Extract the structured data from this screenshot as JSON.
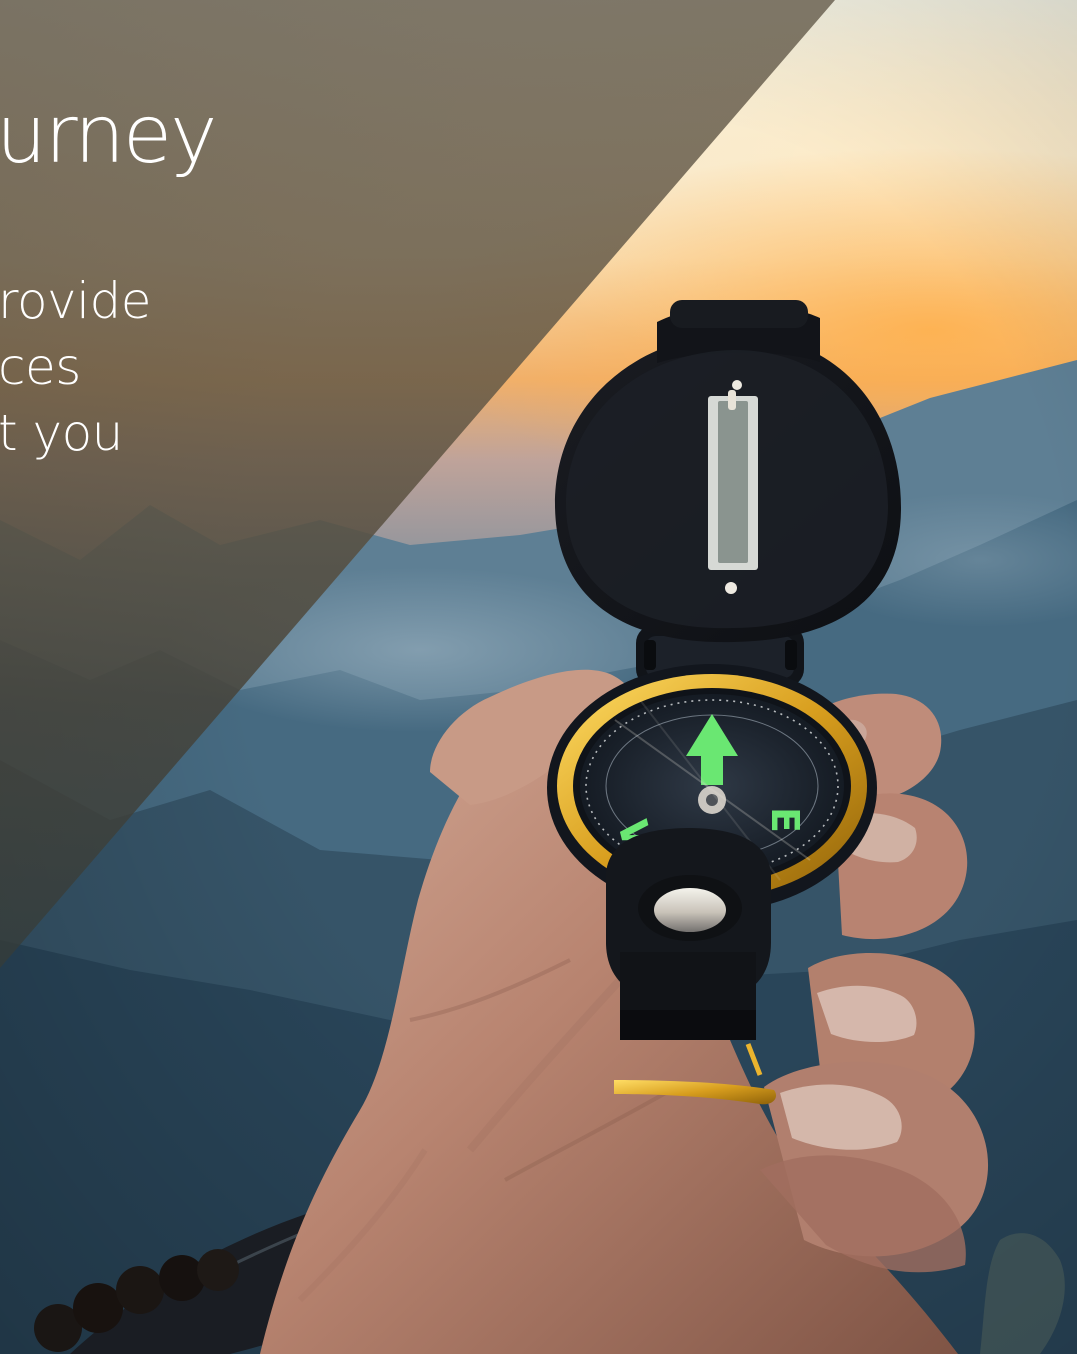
{
  "hero": {
    "headline": "urney",
    "body_lines": [
      "rovide",
      "ces",
      "t you"
    ]
  },
  "visual": {
    "main_subject": "compass-in-hand",
    "accent_colors": {
      "overlay": "#5c594b",
      "sunset": "#f0a24f",
      "sky": "#eef2e8",
      "mountain": "#365468",
      "compass_green": "#5be06c",
      "compass_gold": "#d7a31f"
    },
    "icons": {
      "compass_north": "north-arrow-icon",
      "compass_west": "west-letter-icon",
      "compass_east": "east-letter-icon"
    }
  }
}
